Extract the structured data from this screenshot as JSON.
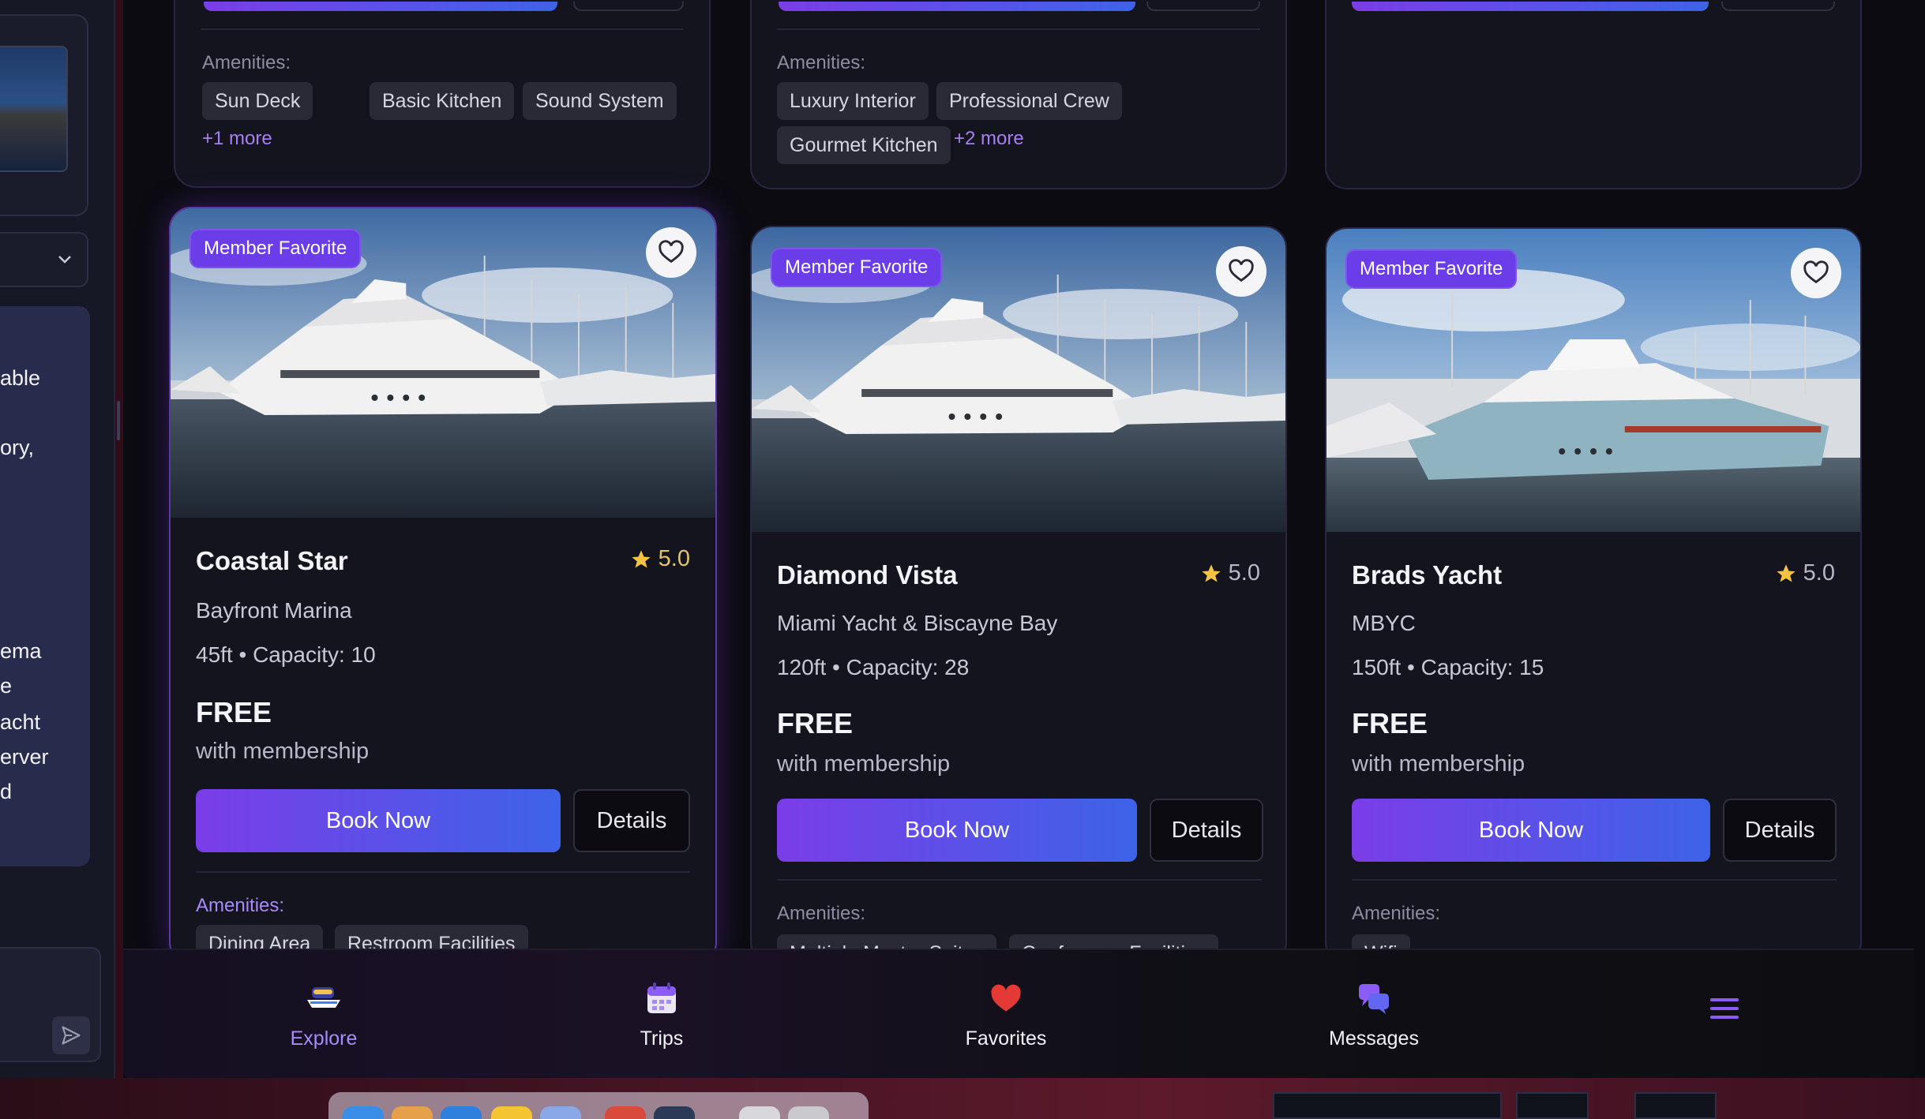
{
  "left_panel": {
    "message_lines": [
      "able",
      "ory,",
      "ema",
      "e",
      "acht",
      "erver",
      "d"
    ]
  },
  "top_cards": [
    {
      "amenities_label": "Amenities:",
      "amenities": [
        "Sun Deck",
        "Basic Kitchen",
        "Sound System"
      ],
      "more": "+1 more"
    },
    {
      "amenities_label": "Amenities:",
      "amenities": [
        "Luxury Interior",
        "Professional Crew",
        "Gourmet Kitchen"
      ],
      "more": "+2 more"
    },
    {}
  ],
  "cards": [
    {
      "badge": "Member Favorite",
      "name": "Coastal Star",
      "rating": "5.0",
      "location": "Bayfront Marina",
      "specs": "45ft • Capacity: 10",
      "price": "FREE",
      "price_sub": "with membership",
      "book_label": "Book Now",
      "details_label": "Details",
      "amenities_label": "Amenities:",
      "amenities": [
        "Dining Area",
        "Restroom Facilities"
      ]
    },
    {
      "badge": "Member Favorite",
      "name": "Diamond Vista",
      "rating": "5.0",
      "location": "Miami Yacht & Biscayne Bay",
      "specs": "120ft • Capacity: 28",
      "price": "FREE",
      "price_sub": "with membership",
      "book_label": "Book Now",
      "details_label": "Details",
      "amenities_label": "Amenities:",
      "amenities": [
        "Multiple Master Suites",
        "Conference Facilities"
      ]
    },
    {
      "badge": "Member Favorite",
      "name": "Brads Yacht",
      "rating": "5.0",
      "location": "MBYC",
      "specs": "150ft • Capacity: 15",
      "price": "FREE",
      "price_sub": "with membership",
      "book_label": "Book Now",
      "details_label": "Details",
      "amenities_label": "Amenities:",
      "amenities": [
        "Wifi"
      ]
    }
  ],
  "bottom_nav": {
    "items": [
      {
        "label": "Explore",
        "icon": "yacht-icon",
        "active": true
      },
      {
        "label": "Trips",
        "icon": "calendar-icon"
      },
      {
        "label": "Favorites",
        "icon": "heart-icon"
      },
      {
        "label": "Messages",
        "icon": "chat-bubbles-icon"
      }
    ],
    "menu_icon": "hamburger-menu-icon"
  },
  "colors": {
    "accent_purple": "#7b3de8",
    "accent_blue": "#3d63e8",
    "badge": "#6a3de8",
    "star": "#f5c242",
    "background": "#0b0b11"
  }
}
